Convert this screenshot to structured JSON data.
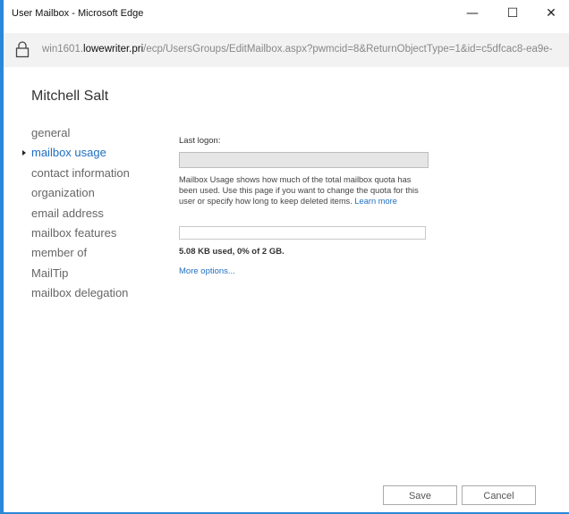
{
  "window": {
    "title": "User Mailbox - Microsoft Edge",
    "minimize_glyph": "—",
    "maximize_glyph": "☐",
    "close_glyph": "✕"
  },
  "address_bar": {
    "url_prefix": "win1601.",
    "url_host": "lowewriter.pri",
    "url_path": "/ecp/UsersGroups/EditMailbox.aspx?pwmcid=8&ReturnObjectType=1&id=c5dfcac8-ea9e-"
  },
  "page": {
    "title": "Mitchell Salt"
  },
  "nav": {
    "items": [
      {
        "label": "general"
      },
      {
        "label": "mailbox usage"
      },
      {
        "label": "contact information"
      },
      {
        "label": "organization"
      },
      {
        "label": "email address"
      },
      {
        "label": "mailbox features"
      },
      {
        "label": "member of"
      },
      {
        "label": "MailTip"
      },
      {
        "label": "mailbox delegation"
      }
    ],
    "active_index": 1
  },
  "content": {
    "last_logon_label": "Last logon:",
    "last_logon_value": "",
    "description": "Mailbox Usage shows how much of the total mailbox quota has been used. Use this page if you want to change the quota for this user or specify how long to keep deleted items.",
    "learn_more": "Learn more",
    "usage_fraction": 0,
    "usage_text": "5.08 KB used, 0% of 2 GB.",
    "more_options": "More options..."
  },
  "footer": {
    "save_label": "Save",
    "cancel_label": "Cancel"
  },
  "colors": {
    "accent": "#2b88d8",
    "link": "#1e6fc0"
  }
}
